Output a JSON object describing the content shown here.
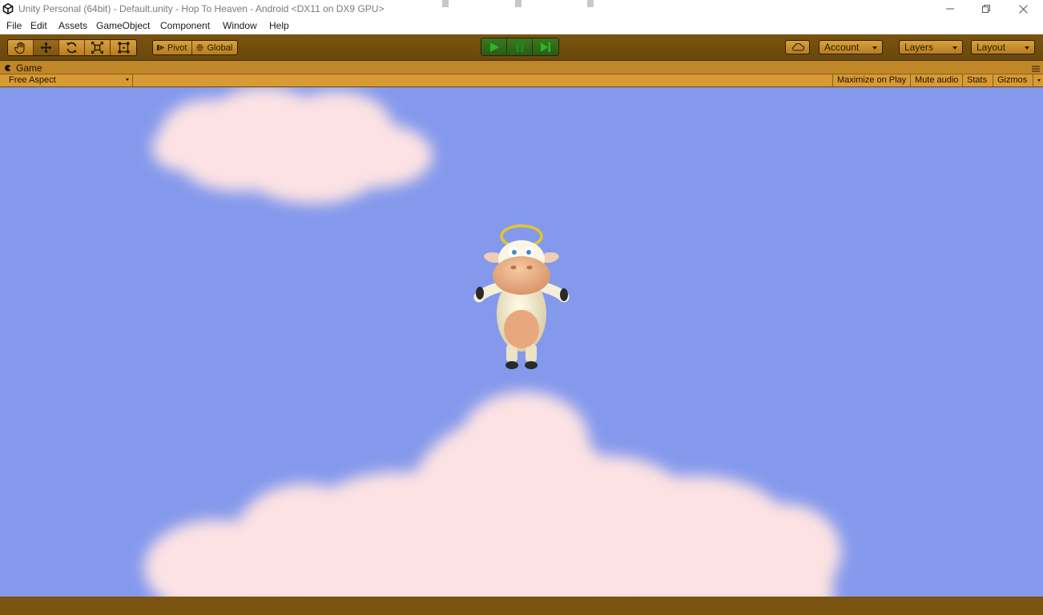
{
  "window": {
    "title": "Unity Personal (64bit) - Default.unity - Hop To Heaven - Android <DX11 on DX9 GPU>",
    "controls": [
      "minimize-icon",
      "restore-icon",
      "close-icon"
    ]
  },
  "menubar": {
    "items": [
      "File",
      "Edit",
      "Assets",
      "GameObject",
      "Component",
      "Window",
      "Help"
    ]
  },
  "toolbar": {
    "transform_tools": [
      {
        "name": "hand-tool",
        "icon": "hand-icon",
        "active": false
      },
      {
        "name": "move-tool",
        "icon": "move-icon",
        "active": true
      },
      {
        "name": "rotate-tool",
        "icon": "rotate-icon",
        "active": false
      },
      {
        "name": "scale-tool",
        "icon": "scale-icon",
        "active": false
      },
      {
        "name": "rect-tool",
        "icon": "rect-icon",
        "active": false
      }
    ],
    "pivot_label": "Pivot",
    "global_label": "Global",
    "play_controls": [
      "play-icon",
      "pause-icon",
      "step-icon"
    ],
    "play_active": true,
    "cloud_icon": "cloud-icon",
    "account_label": "Account",
    "layers_label": "Layers",
    "layout_label": "Layout"
  },
  "game_panel": {
    "tab_label": "Game",
    "aspect_label": "Free Aspect",
    "options": [
      "Maximize on Play",
      "Mute audio",
      "Stats",
      "Gizmos"
    ]
  },
  "scene": {
    "sky_color": "#8499ec",
    "cloud_color": "#fde2e3",
    "character": "angel-cow"
  },
  "colors": {
    "toolbar": "#7a5410",
    "button": "#c98f2f",
    "play_active": "#2f6a18"
  }
}
